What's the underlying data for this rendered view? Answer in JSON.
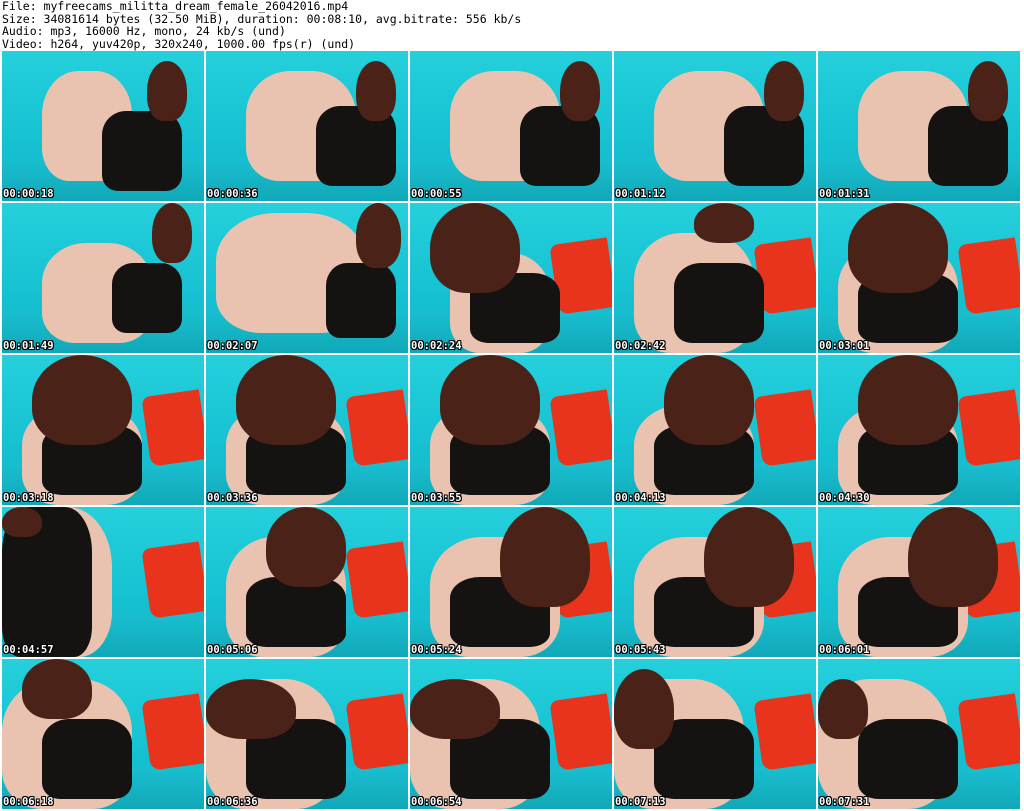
{
  "header": {
    "file_line": "File: myfreecams_militta_dream_female_26042016.mp4",
    "size_line": "Size: 34081614 bytes (32.50 MiB), duration: 00:08:10, avg.bitrate: 556 kb/s",
    "audio_line": "Audio: mp3, 16000 Hz, mono, 24 kb/s (und)",
    "video_line": "Video: h264, yuv420p, 320x240, 1000.00 fps(r) (und)"
  },
  "thumbnails": [
    {
      "timestamp": "00:00:18"
    },
    {
      "timestamp": "00:00:36"
    },
    {
      "timestamp": "00:00:55"
    },
    {
      "timestamp": "00:01:12"
    },
    {
      "timestamp": "00:01:31"
    },
    {
      "timestamp": "00:01:49"
    },
    {
      "timestamp": "00:02:07"
    },
    {
      "timestamp": "00:02:24"
    },
    {
      "timestamp": "00:02:42"
    },
    {
      "timestamp": "00:03:01"
    },
    {
      "timestamp": "00:03:18"
    },
    {
      "timestamp": "00:03:36"
    },
    {
      "timestamp": "00:03:55"
    },
    {
      "timestamp": "00:04:13"
    },
    {
      "timestamp": "00:04:30"
    },
    {
      "timestamp": "00:04:57"
    },
    {
      "timestamp": "00:05:06"
    },
    {
      "timestamp": "00:05:24"
    },
    {
      "timestamp": "00:05:43"
    },
    {
      "timestamp": "00:06:01"
    },
    {
      "timestamp": "00:06:18"
    },
    {
      "timestamp": "00:06:36"
    },
    {
      "timestamp": "00:06:54"
    },
    {
      "timestamp": "00:07:13"
    },
    {
      "timestamp": "00:07:31"
    }
  ]
}
